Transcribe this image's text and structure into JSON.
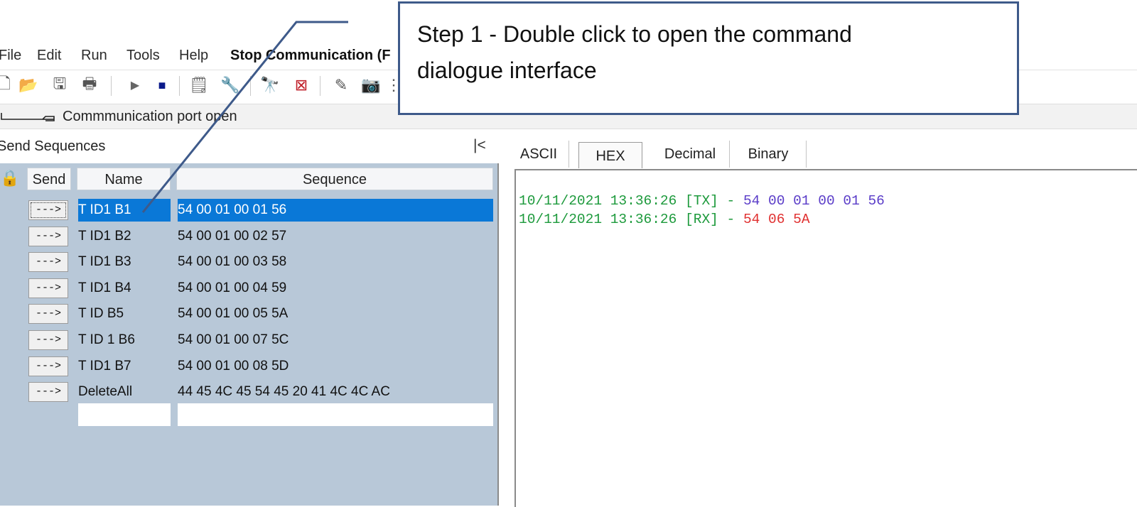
{
  "menu": {
    "items": [
      "File",
      "Edit",
      "Run",
      "Tools",
      "Help"
    ],
    "stop_label": "Stop Communication (F"
  },
  "status": {
    "text": "Commmunication port open"
  },
  "panel": {
    "title": "Send Sequences",
    "collapse": "|<",
    "columns": {
      "send": "Send",
      "name": "Name",
      "sequence": "Sequence"
    },
    "send_label": "--->",
    "rows": [
      {
        "name": "T ID1 B1",
        "sequence": "54 00 01 00 01 56"
      },
      {
        "name": "T ID1 B2",
        "sequence": "54 00 01 00 02 57"
      },
      {
        "name": "T ID1 B3",
        "sequence": "54 00 01 00 03 58"
      },
      {
        "name": "T ID1 B4",
        "sequence": "54 00 01 00 04 59"
      },
      {
        "name": "T ID B5",
        "sequence": "54 00 01 00 05 5A"
      },
      {
        "name": "T ID 1 B6",
        "sequence": "54 00 01 00 07 5C"
      },
      {
        "name": "T ID1 B7",
        "sequence": "54 00 01 00 08 5D"
      },
      {
        "name": "DeleteAll",
        "sequence": "44 45 4C 45 54 45 20 41 4C 4C AC"
      }
    ]
  },
  "tabs": [
    "ASCII",
    "HEX",
    "Decimal",
    "Binary"
  ],
  "log": [
    {
      "prefix": "10/11/2021 13:36:26 [TX] - ",
      "bytes": "54 00 01 00 01 56"
    },
    {
      "prefix": "10/11/2021 13:36:26 [RX] - ",
      "bytes": "54 06 5A"
    }
  ],
  "callout": {
    "line1": "Step 1 - Double click to open the command",
    "line2": "dialogue interface"
  },
  "colors": {
    "selection": "#0a78d7",
    "log_timestamp": "#1d9a3c",
    "log_tx_bytes": "#5a3cc8",
    "log_rx_bytes": "#e03030",
    "callout_border": "#3e5a8a"
  }
}
